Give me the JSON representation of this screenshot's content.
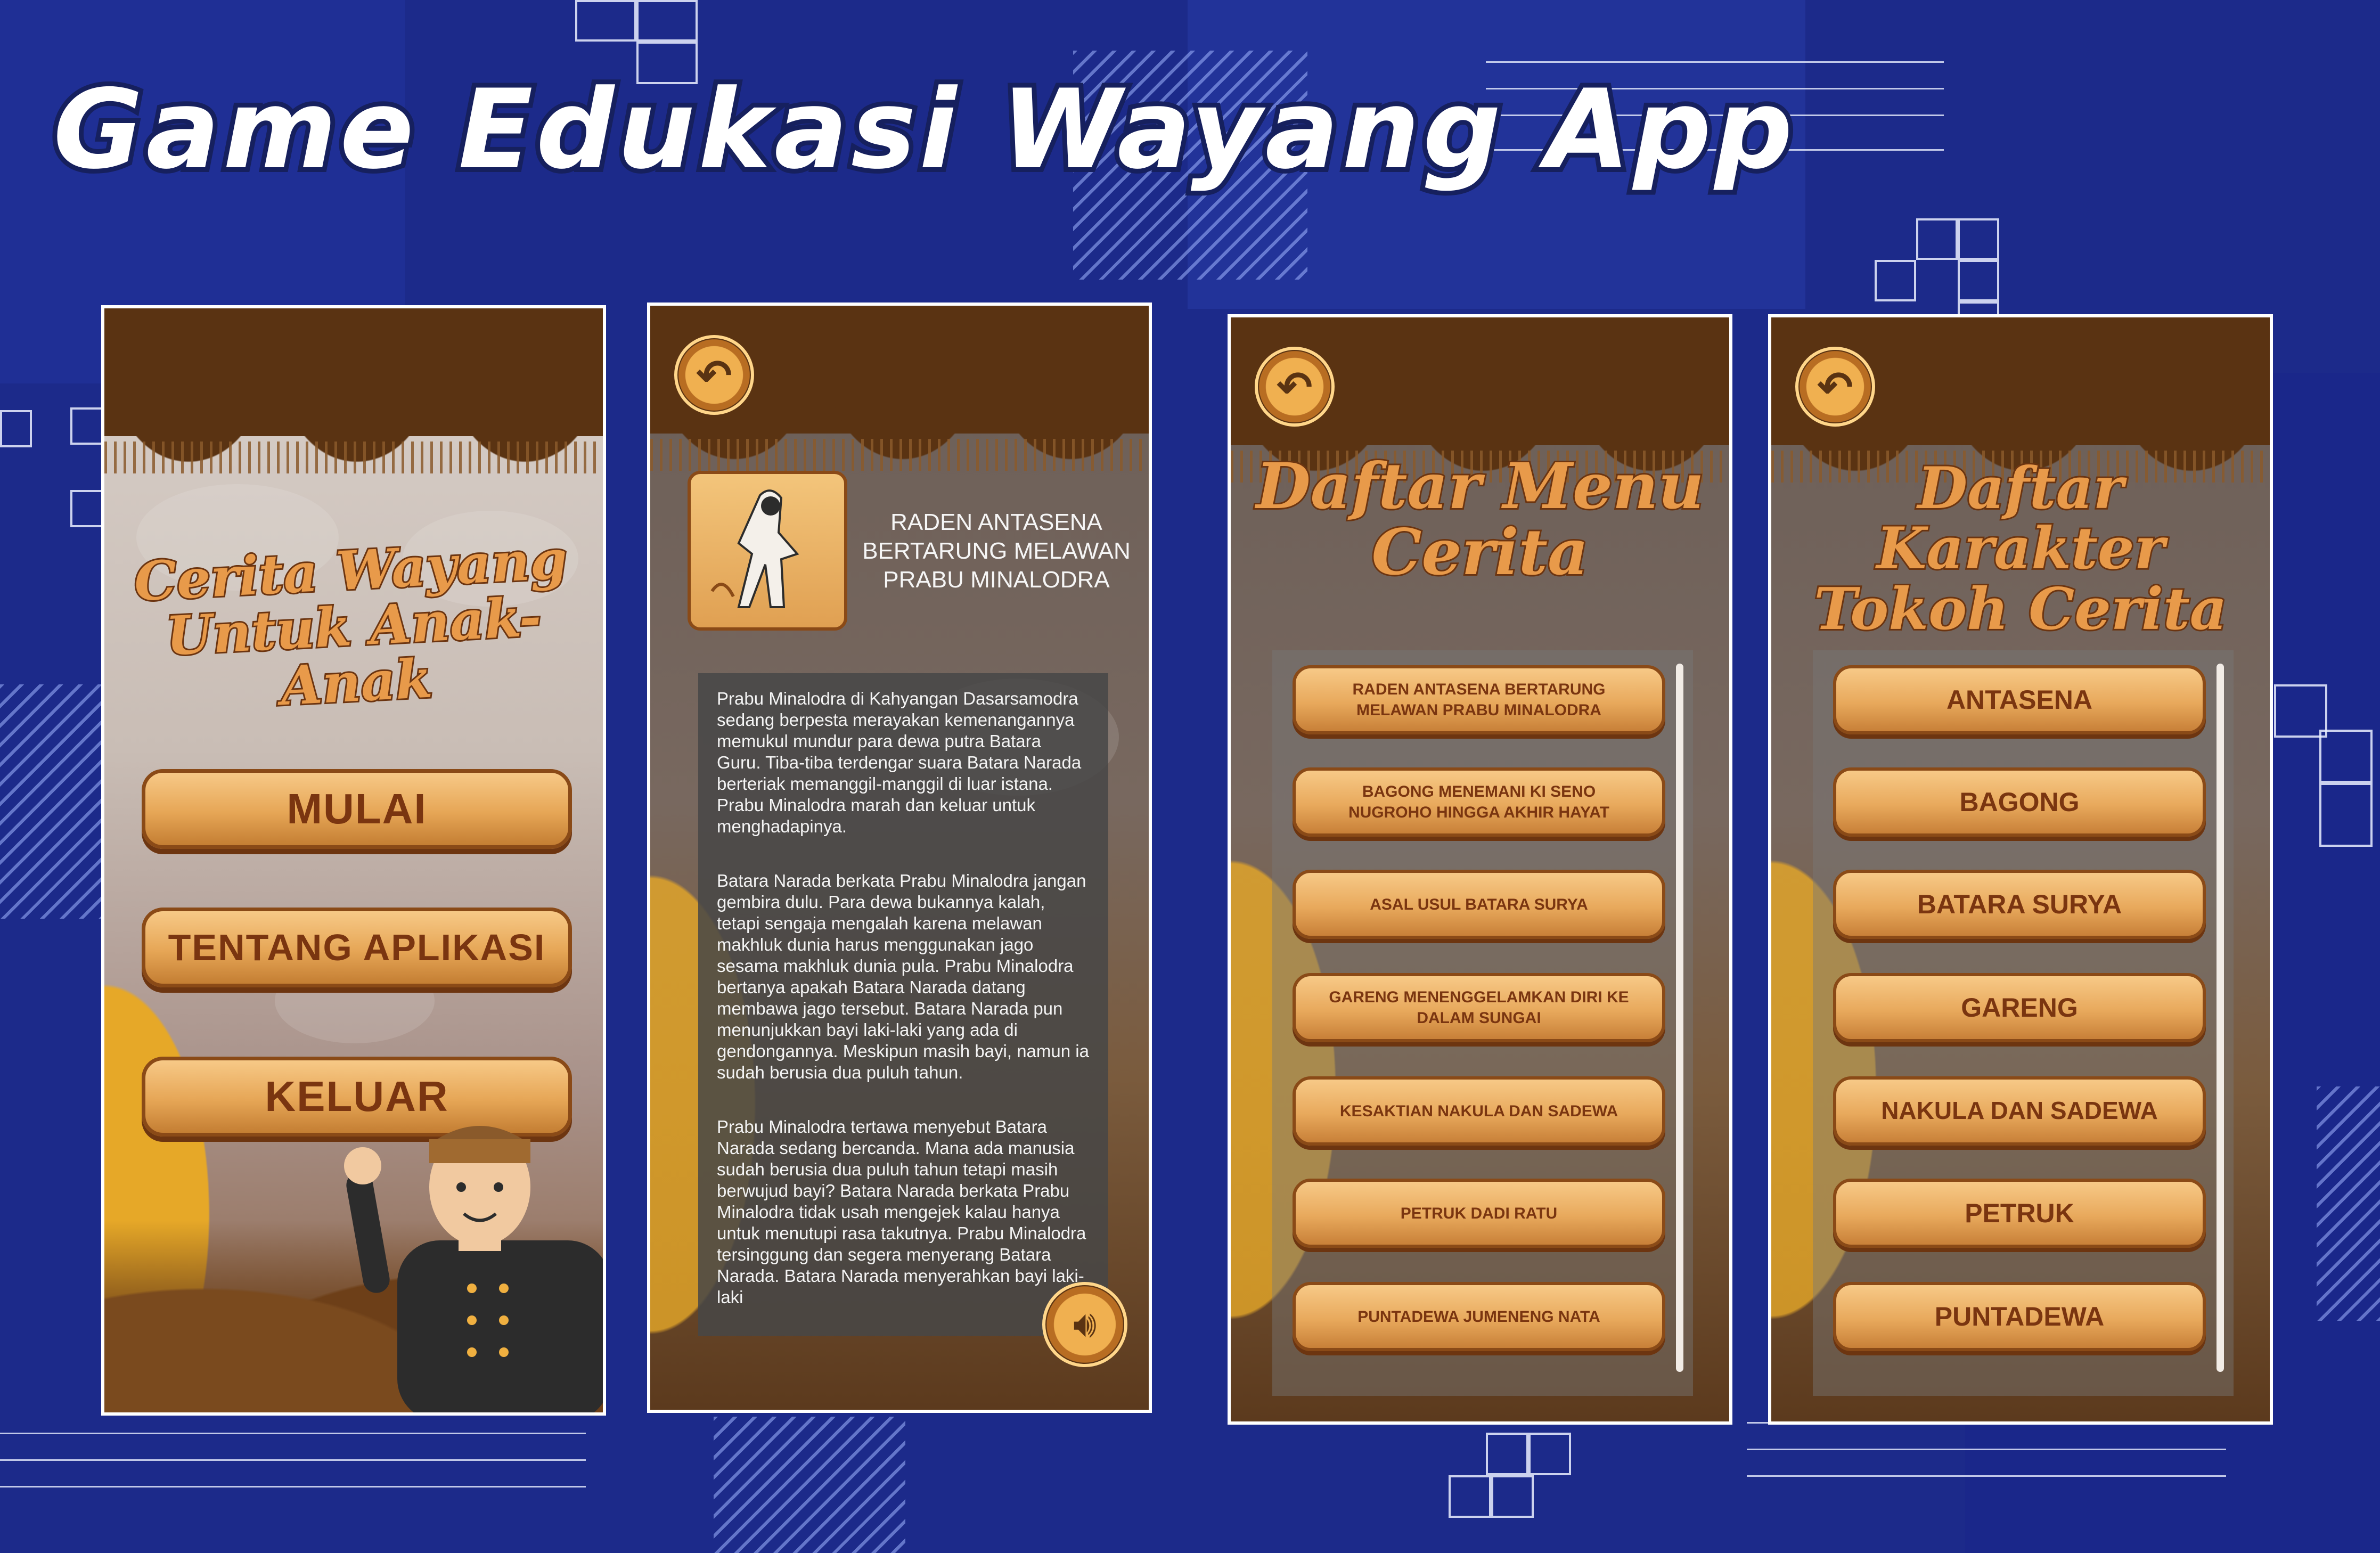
{
  "page_title": "Game Edukasi Wayang App",
  "screens": {
    "home": {
      "title_line1": "Cerita Wayang",
      "title_line2": "Untuk Anak-Anak",
      "buttons": [
        "MULAI",
        "TENTANG APLIKASI",
        "KELUAR"
      ]
    },
    "story": {
      "title": "RADEN ANTASENA BERTARUNG MELAWAN PRABU MINALODRA",
      "paragraphs": [
        "Prabu Minalodra di Kahyangan Dasarsamodra sedang berpesta merayakan kemenangannya memukul mundur para dewa putra Batara Guru. Tiba-tiba terdengar suara Batara Narada berteriak memanggil-manggil di luar istana. Prabu Minalodra marah dan keluar untuk menghadapinya.",
        "Batara Narada berkata Prabu Minalodra jangan gembira dulu. Para dewa bukannya kalah, tetapi sengaja mengalah karena melawan makhluk dunia harus menggunakan jago sesama makhluk dunia pula. Prabu Minalodra bertanya apakah Batara Narada datang membawa jago tersebut. Batara Narada pun menunjukkan bayi laki-laki yang ada di gendongannya. Meskipun masih bayi, namun ia sudah berusia dua puluh tahun.",
        "Prabu Minalodra tertawa menyebut Batara Narada sedang bercanda. Mana ada manusia sudah berusia dua puluh tahun tetapi masih berwujud bayi? Batara Narada berkata Prabu Minalodra tidak usah mengejek kalau hanya untuk menutupi rasa takutnya. Prabu Minalodra tersinggung dan segera menyerang Batara Narada. Batara Narada menyerahkan bayi laki-laki"
      ]
    },
    "story_menu": {
      "title_line1": "Daftar Menu",
      "title_line2": "Cerita",
      "items": [
        "RADEN ANTASENA BERTARUNG MELAWAN PRABU MINALODRA",
        "BAGONG MENEMANI KI SENO NUGROHO HINGGA AKHIR HAYAT",
        "ASAL USUL BATARA SURYA",
        "GARENG MENENGGELAMKAN DIRI KE DALAM SUNGAI",
        "KESAKTIAN NAKULA DAN SADEWA",
        "PETRUK DADI RATU",
        "PUNTADEWA JUMENENG NATA"
      ]
    },
    "character_menu": {
      "title_line1": "Daftar Karakter",
      "title_line2": "Tokoh Cerita",
      "items": [
        "ANTASENA",
        "BAGONG",
        "BATARA SURYA",
        "GARENG",
        "NAKULA DAN SADEWA",
        "PETRUK",
        "PUNTADEWA"
      ]
    }
  },
  "icons": {
    "back": "back-arrow-icon",
    "sound": "speaker-icon"
  },
  "colors": {
    "background": "#1c2a8a",
    "curtain": "#5a3312",
    "button": "#e6a656",
    "button_text": "#7a3510"
  }
}
